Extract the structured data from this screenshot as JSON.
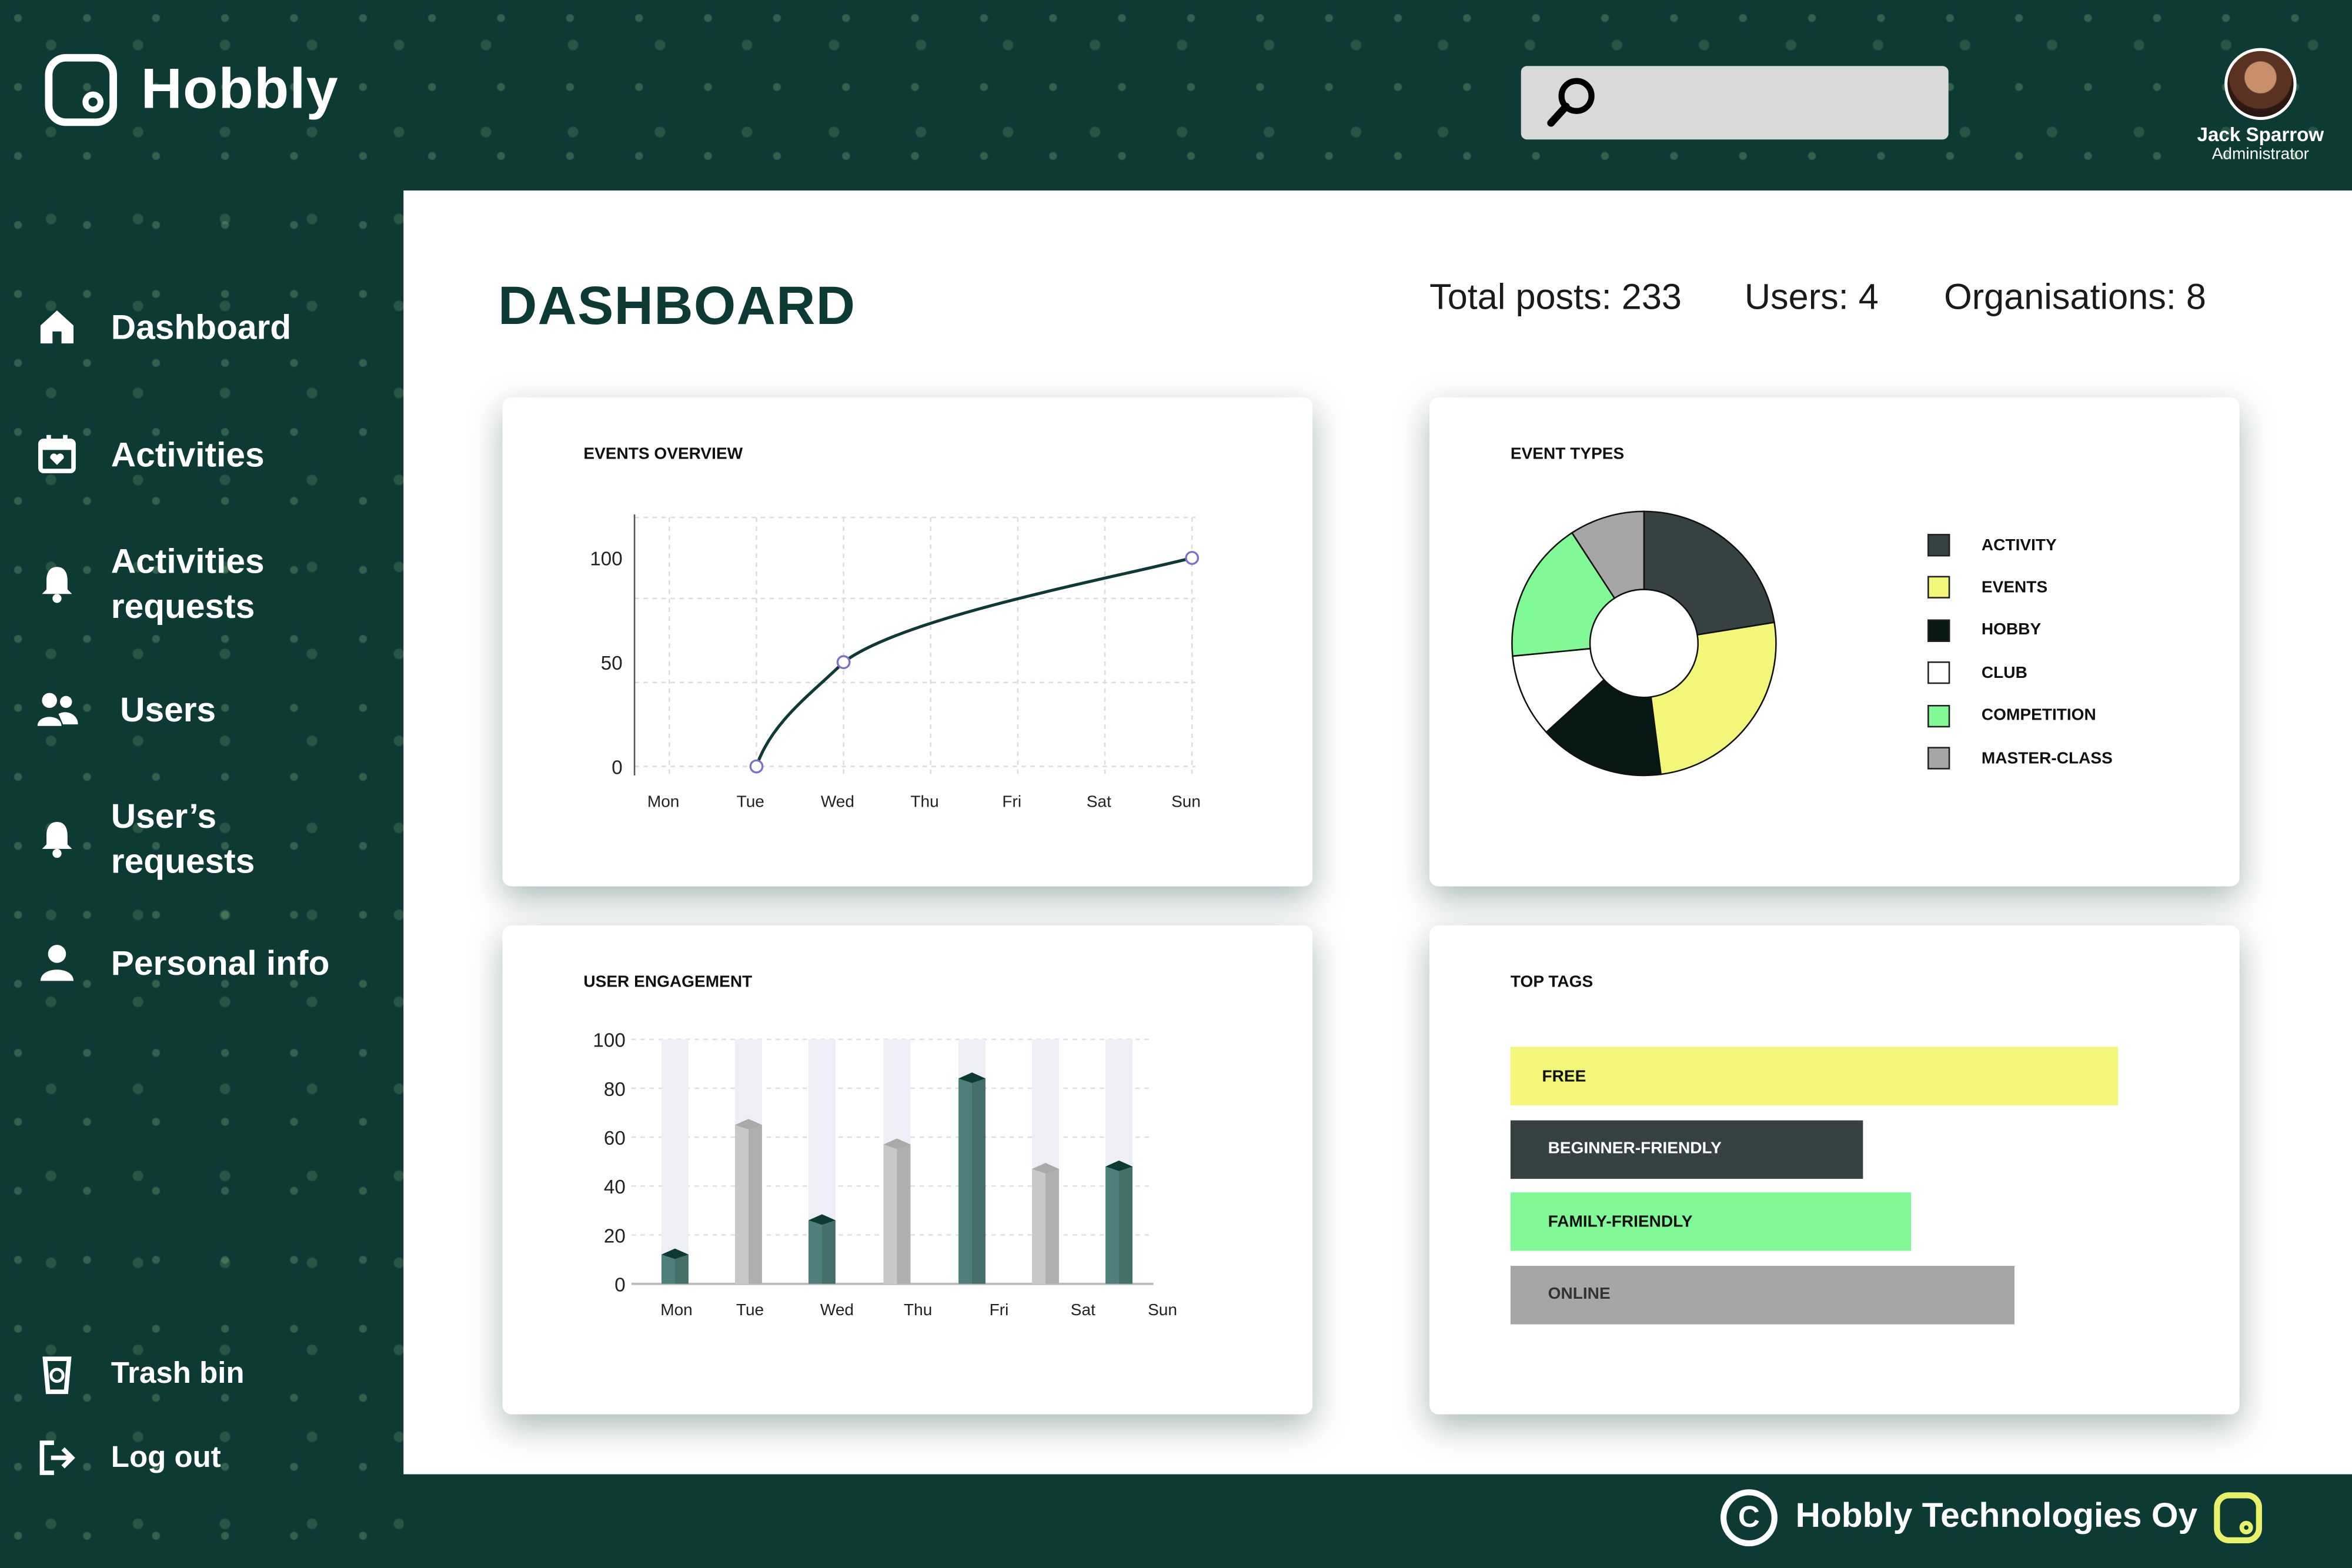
{
  "app": {
    "name": "Hobbly"
  },
  "search": {
    "placeholder": ""
  },
  "user": {
    "name": "Jack Sparrow",
    "role": "Administrator"
  },
  "sidebar": {
    "items": [
      {
        "label": "Dashboard",
        "icon": "home-icon"
      },
      {
        "label": "Activities",
        "icon": "calendar-icon"
      },
      {
        "label": "Activities requests",
        "icon": "bell-icon"
      },
      {
        "label": "Users",
        "icon": "users-icon"
      },
      {
        "label": "User’s requests",
        "icon": "bell-icon"
      },
      {
        "label": "Personal info",
        "icon": "person-icon"
      },
      {
        "label": "Trash bin",
        "icon": "trash-icon"
      },
      {
        "label": "Log out",
        "icon": "logout-icon"
      }
    ]
  },
  "main": {
    "title": "DASHBOARD",
    "stats": {
      "posts": "Total posts: 233",
      "users": "Users: 4",
      "organisations": "Organisations: 8"
    }
  },
  "colors": {
    "brand": "#0e3a36",
    "accent_yellow": "#f2f77a",
    "accent_green": "#80f996",
    "dark_slate": "#364242",
    "grey": "#a6a6a6"
  },
  "footer": {
    "text": "Hobbly Technologies Oy",
    "copyright_symbol": "C"
  },
  "chart_data": [
    {
      "type": "line",
      "title": "EVENTS OVERVIEW",
      "categories": [
        "Mon",
        "Tue",
        "Wed",
        "Thu",
        "Fri",
        "Sat",
        "Sun"
      ],
      "x": [
        "Tue",
        "Wed",
        "Sun"
      ],
      "values": [
        0,
        50,
        100
      ],
      "ylim": [
        0,
        100
      ],
      "yticks": [
        0,
        50,
        100
      ],
      "grid": true
    },
    {
      "type": "pie",
      "title": "EVENT TYPES",
      "labels": [
        "ACTIVITY",
        "EVENTS",
        "HOBBY",
        "CLUB",
        "COMPETITION",
        "MASTER-CLASS"
      ],
      "values": [
        22,
        25,
        15,
        10,
        17,
        9
      ],
      "colors": [
        "#364242",
        "#f2f77a",
        "#061714",
        "#ffffff",
        "#80f996",
        "#a6a6a6"
      ],
      "legend": "right"
    },
    {
      "type": "bar",
      "title": "USER ENGAGEMENT",
      "categories": [
        "Mon",
        "Tue",
        "Wed",
        "Thu",
        "Fri",
        "Sat",
        "Sun"
      ],
      "values": [
        12,
        65,
        26,
        57,
        84,
        47,
        48
      ],
      "colors": [
        "#4f7f7a",
        "#c8c8c8",
        "#4f7f7a",
        "#c8c8c8",
        "#4f7f7a",
        "#c8c8c8",
        "#4f7f7a"
      ],
      "ylim": [
        0,
        100
      ],
      "yticks": [
        0,
        20,
        40,
        60,
        80,
        100
      ],
      "grid": true
    },
    {
      "type": "bar",
      "title": "TOP TAGS",
      "orientation": "horizontal",
      "categories": [
        "FREE",
        "BEGINNER-FRIENDLY",
        "FAMILY-FRIENDLY",
        "ONLINE"
      ],
      "values": [
        100,
        58,
        66,
        83
      ],
      "colors": [
        "#f2f77a",
        "#364242",
        "#80f996",
        "#a6a6a6"
      ],
      "text_colors": [
        "#111111",
        "#ffffff",
        "#111111",
        "#333333"
      ]
    }
  ]
}
